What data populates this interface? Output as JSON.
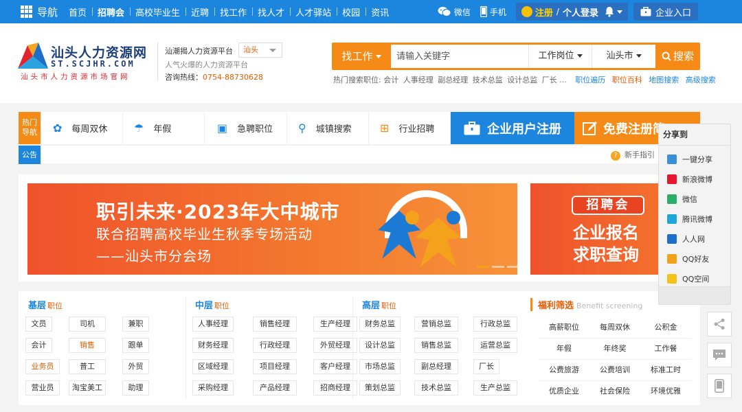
{
  "topbar": {
    "nav_title": "导航",
    "menu": [
      "首页",
      "招聘会",
      "高校毕业生",
      "近聘",
      "找工作",
      "找人才",
      "人才驿站",
      "校园",
      "资讯"
    ],
    "wechat": "微信",
    "mobile": "手机",
    "register": "注册",
    "separator": "/",
    "login": "个人登录",
    "corp_entry": "企业入口"
  },
  "header": {
    "logo_cn": "汕头人力资源网",
    "logo_en": "ST.SCJHR.COM",
    "logo_sub": "汕头市人力资源市场官网",
    "platform": "汕潮揭人力资源平台",
    "city": "汕头",
    "slogan": "人气火爆的人力资源平台",
    "hotline_label": "咨询热线：",
    "hotline": "0754-88730628"
  },
  "search": {
    "type": "找工作",
    "placeholder": "请输入关键字",
    "job_select": "工作岗位",
    "city_select": "汕头市",
    "button": "搜索",
    "hot_label": "热门搜索职位:",
    "hot": [
      "会计",
      "人事经理",
      "副总经理",
      "技术总监",
      "设计总监",
      "厂长 ..."
    ],
    "links_blue": [
      "职位遍历"
    ],
    "link_orange": "职位百科",
    "links_blue2": [
      "地图搜索",
      "高级搜索"
    ]
  },
  "hotnav": {
    "label": "热门导航",
    "items": [
      "每周双休",
      "年假",
      "急聘职位",
      "城镇搜索",
      "行业招聘"
    ],
    "corp_register": "企业用户注册",
    "free_register": "免费注册简"
  },
  "notice": {
    "label": "公告",
    "guide": "新手指引"
  },
  "banner1": {
    "line1": "职引未来·2023年大中城市",
    "line2": "联合招聘高校毕业生秋季专场活动",
    "line3": "——汕头市分会场"
  },
  "banner2": {
    "tag": "招聘会",
    "line1": "企业报名",
    "line2": "求职查询"
  },
  "categories": {
    "basic": {
      "title": "基层",
      "suffix": "职位",
      "rows": [
        [
          "文员",
          "司机",
          "兼职"
        ],
        [
          "会计",
          "销售",
          "跟单"
        ],
        [
          "业务员",
          "普工",
          "外贸"
        ],
        [
          "营业员",
          "淘宝美工",
          "助理"
        ]
      ]
    },
    "middle": {
      "title": "中层",
      "suffix": "职位",
      "rows": [
        [
          "人事经理",
          "销售经理",
          "生产经理"
        ],
        [
          "财务经理",
          "行政经理",
          "外贸经理"
        ],
        [
          "区域经理",
          "项目经理",
          "客户经理"
        ],
        [
          "采购经理",
          "产品经理",
          "招商经理"
        ]
      ]
    },
    "senior": {
      "title": "高层",
      "suffix": "职位",
      "rows": [
        [
          "财务总监",
          "营销总监",
          "行政总监"
        ],
        [
          "设计总监",
          "销售总监",
          "运营总监"
        ],
        [
          "市场总监",
          "副总经理",
          "厂长"
        ],
        [
          "策划总监",
          "技术总监",
          "生产总监"
        ]
      ]
    },
    "welfare": {
      "title": "福利筛选",
      "en": "Benefit screening",
      "rows": [
        [
          "高薪职位",
          "每周双休",
          "公积金"
        ],
        [
          "年假",
          "年终奖",
          "工作餐"
        ],
        [
          "公费旅游",
          "公费培训",
          "标准工时"
        ],
        [
          "优质企业",
          "社会保险",
          "环境优雅"
        ]
      ]
    }
  },
  "share": {
    "title": "分享到",
    "items": [
      "一键分享",
      "新浪微博",
      "微信",
      "腾讯微博",
      "人人网",
      "QQ好友",
      "QQ空间"
    ],
    "icon_colors": [
      "#3b8fd8",
      "#e6162d",
      "#2aae67",
      "#1fa5d8",
      "#1c6ec8",
      "#f2a11a",
      "#f4c21b"
    ]
  },
  "colors": {
    "brand_blue": "#1c86df",
    "brand_orange": "#f58b16",
    "accent_red": "#e75b00"
  }
}
